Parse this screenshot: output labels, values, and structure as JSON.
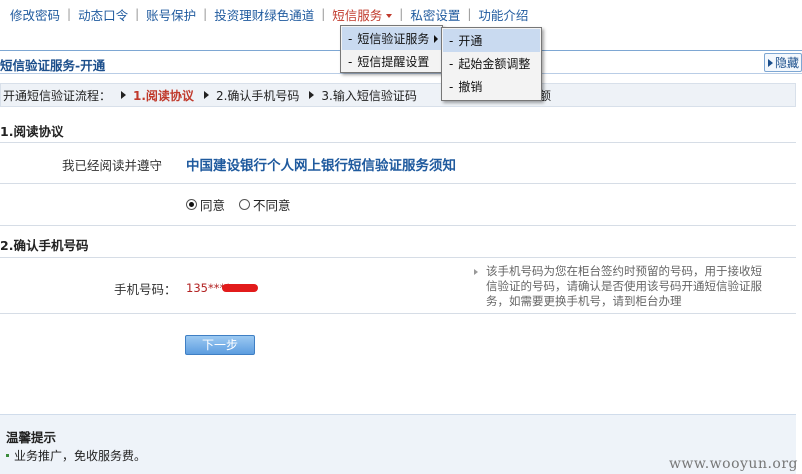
{
  "nav": {
    "items": [
      {
        "label": "修改密码"
      },
      {
        "label": "动态口令"
      },
      {
        "label": "账号保护"
      },
      {
        "label": "投资理财绿色通道"
      },
      {
        "label": "短信服务"
      },
      {
        "label": "私密设置"
      },
      {
        "label": "功能介绍"
      }
    ],
    "separator": "|"
  },
  "menu": {
    "level1": [
      {
        "label": "短信验证服务"
      },
      {
        "label": "短信提醒设置"
      }
    ],
    "level2": [
      {
        "label": "开通"
      },
      {
        "label": "起始金额调整"
      },
      {
        "label": "撤销"
      }
    ],
    "dash": "-"
  },
  "page": {
    "title": "短信验证服务-开通",
    "hide_label": "隐藏"
  },
  "steps": {
    "label": "开通短信验证流程：",
    "items": [
      {
        "label": "1.阅读协议"
      },
      {
        "label": "2.确认手机号码"
      },
      {
        "label": "3.输入短信验证码"
      }
    ],
    "tail_visible": "额"
  },
  "section1": {
    "heading": "1.阅读协议",
    "agree_label": "我已经阅读并遵守",
    "agreement_link": "中国建设银行个人网上银行短信验证服务须知",
    "radio_agree": "同意",
    "radio_disagree": "不同意"
  },
  "section2": {
    "heading": "2.确认手机号码",
    "phone_label": "手机号码：",
    "phone_value": "135****",
    "hint_lines": [
      "该手机号码为您在柜台签约时预留的号码，用于接收短",
      "信验证的号码，请确认是否使用该号码开通短信验证服",
      "务，如需要更换手机号，请到柜台办理"
    ]
  },
  "next_button": "下一步",
  "tips": {
    "title": "温馨提示",
    "item": "业务推广，免收服务费。"
  },
  "watermark": "www.wooyun.org",
  "colors": {
    "link": "#1f5a9e",
    "active": "#c0392b",
    "menu_highlight": "#c9daf0"
  }
}
